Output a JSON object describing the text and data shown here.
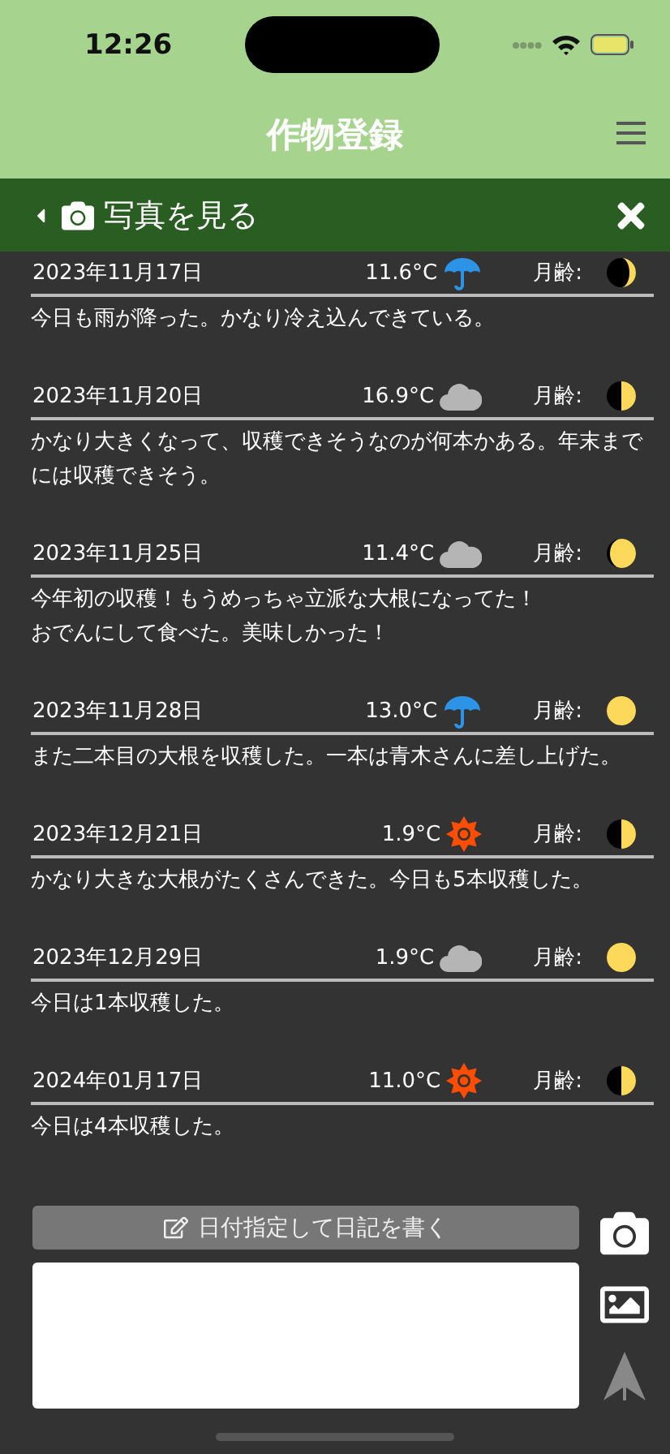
{
  "status_bar": {
    "time": "12:26"
  },
  "header": {
    "title": "作物登録"
  },
  "photo_bar": {
    "label": "写真を見る"
  },
  "diary_entries": [
    {
      "date": "2023年11月17日",
      "temperature": "11.6°C",
      "weather": {
        "kind": "rain"
      },
      "moon_label": "月齢:",
      "moon": {
        "kind": "waxing_crescent"
      },
      "text_lines": [
        "今日も雨が降った。かなり冷え込んできている。"
      ]
    },
    {
      "date": "2023年11月20日",
      "temperature": "16.9°C",
      "weather": {
        "kind": "cloudy"
      },
      "moon_label": "月齢:",
      "moon": {
        "kind": "first_quarter"
      },
      "text_lines": [
        "かなり大きくなって、収穫できそうなのが何本かある。年末までには収穫できそう。"
      ]
    },
    {
      "date": "2023年11月25日",
      "temperature": "11.4°C",
      "weather": {
        "kind": "cloudy"
      },
      "moon_label": "月齢:",
      "moon": {
        "kind": "waxing_gibbous"
      },
      "text_lines": [
        "今年初の収穫！もうめっちゃ立派な大根になってた！",
        "おでんにして食べた。美味しかった！"
      ]
    },
    {
      "date": "2023年11月28日",
      "temperature": "13.0°C",
      "weather": {
        "kind": "rain"
      },
      "moon_label": "月齢:",
      "moon": {
        "kind": "full"
      },
      "text_lines": [
        "また二本目の大根を収穫した。一本は青木さんに差し上げた。"
      ]
    },
    {
      "date": "2023年12月21日",
      "temperature": "1.9°C",
      "weather": {
        "kind": "sunny"
      },
      "moon_label": "月齢:",
      "moon": {
        "kind": "first_quarter"
      },
      "text_lines": [
        "かなり大きな大根がたくさんできた。今日も5本収穫した。"
      ]
    },
    {
      "date": "2023年12月29日",
      "temperature": "1.9°C",
      "weather": {
        "kind": "cloudy"
      },
      "moon_label": "月齢:",
      "moon": {
        "kind": "full"
      },
      "text_lines": [
        "今日は1本収穫した。"
      ]
    },
    {
      "date": "2024年01月17日",
      "temperature": "11.0°C",
      "weather": {
        "kind": "sunny"
      },
      "moon_label": "月齢:",
      "moon": {
        "kind": "first_quarter"
      },
      "text_lines": [
        "今日は4本収穫した。"
      ]
    }
  ],
  "composer": {
    "button_label": "日付指定して日記を書く"
  }
}
